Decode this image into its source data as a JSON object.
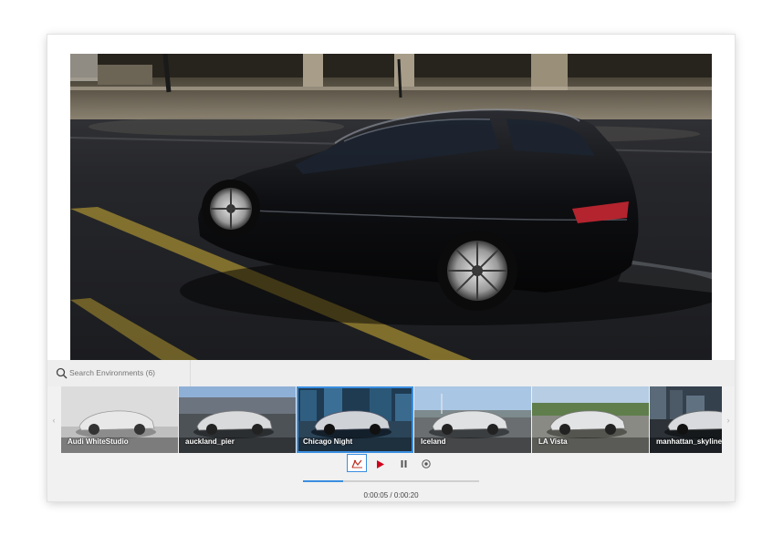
{
  "search": {
    "placeholder": "Search Environments (6)"
  },
  "environments": [
    {
      "label": "Audi WhiteStudio",
      "scene": "studio"
    },
    {
      "label": "auckland_pier",
      "scene": "pier"
    },
    {
      "label": "Chicago Night",
      "scene": "night",
      "selected": true
    },
    {
      "label": "Iceland",
      "scene": "iceland"
    },
    {
      "label": "LA Vista",
      "scene": "lavista"
    },
    {
      "label": "manhattan_skyline",
      "scene": "manhattan"
    }
  ],
  "player": {
    "current_time": "0:00:05",
    "total_time": "0:00:20",
    "time_display": "0:00:05 / 0:00:20",
    "progress_fraction": 0.23
  },
  "colors": {
    "accent": "#3a8ee0",
    "play": "#d0021b"
  }
}
